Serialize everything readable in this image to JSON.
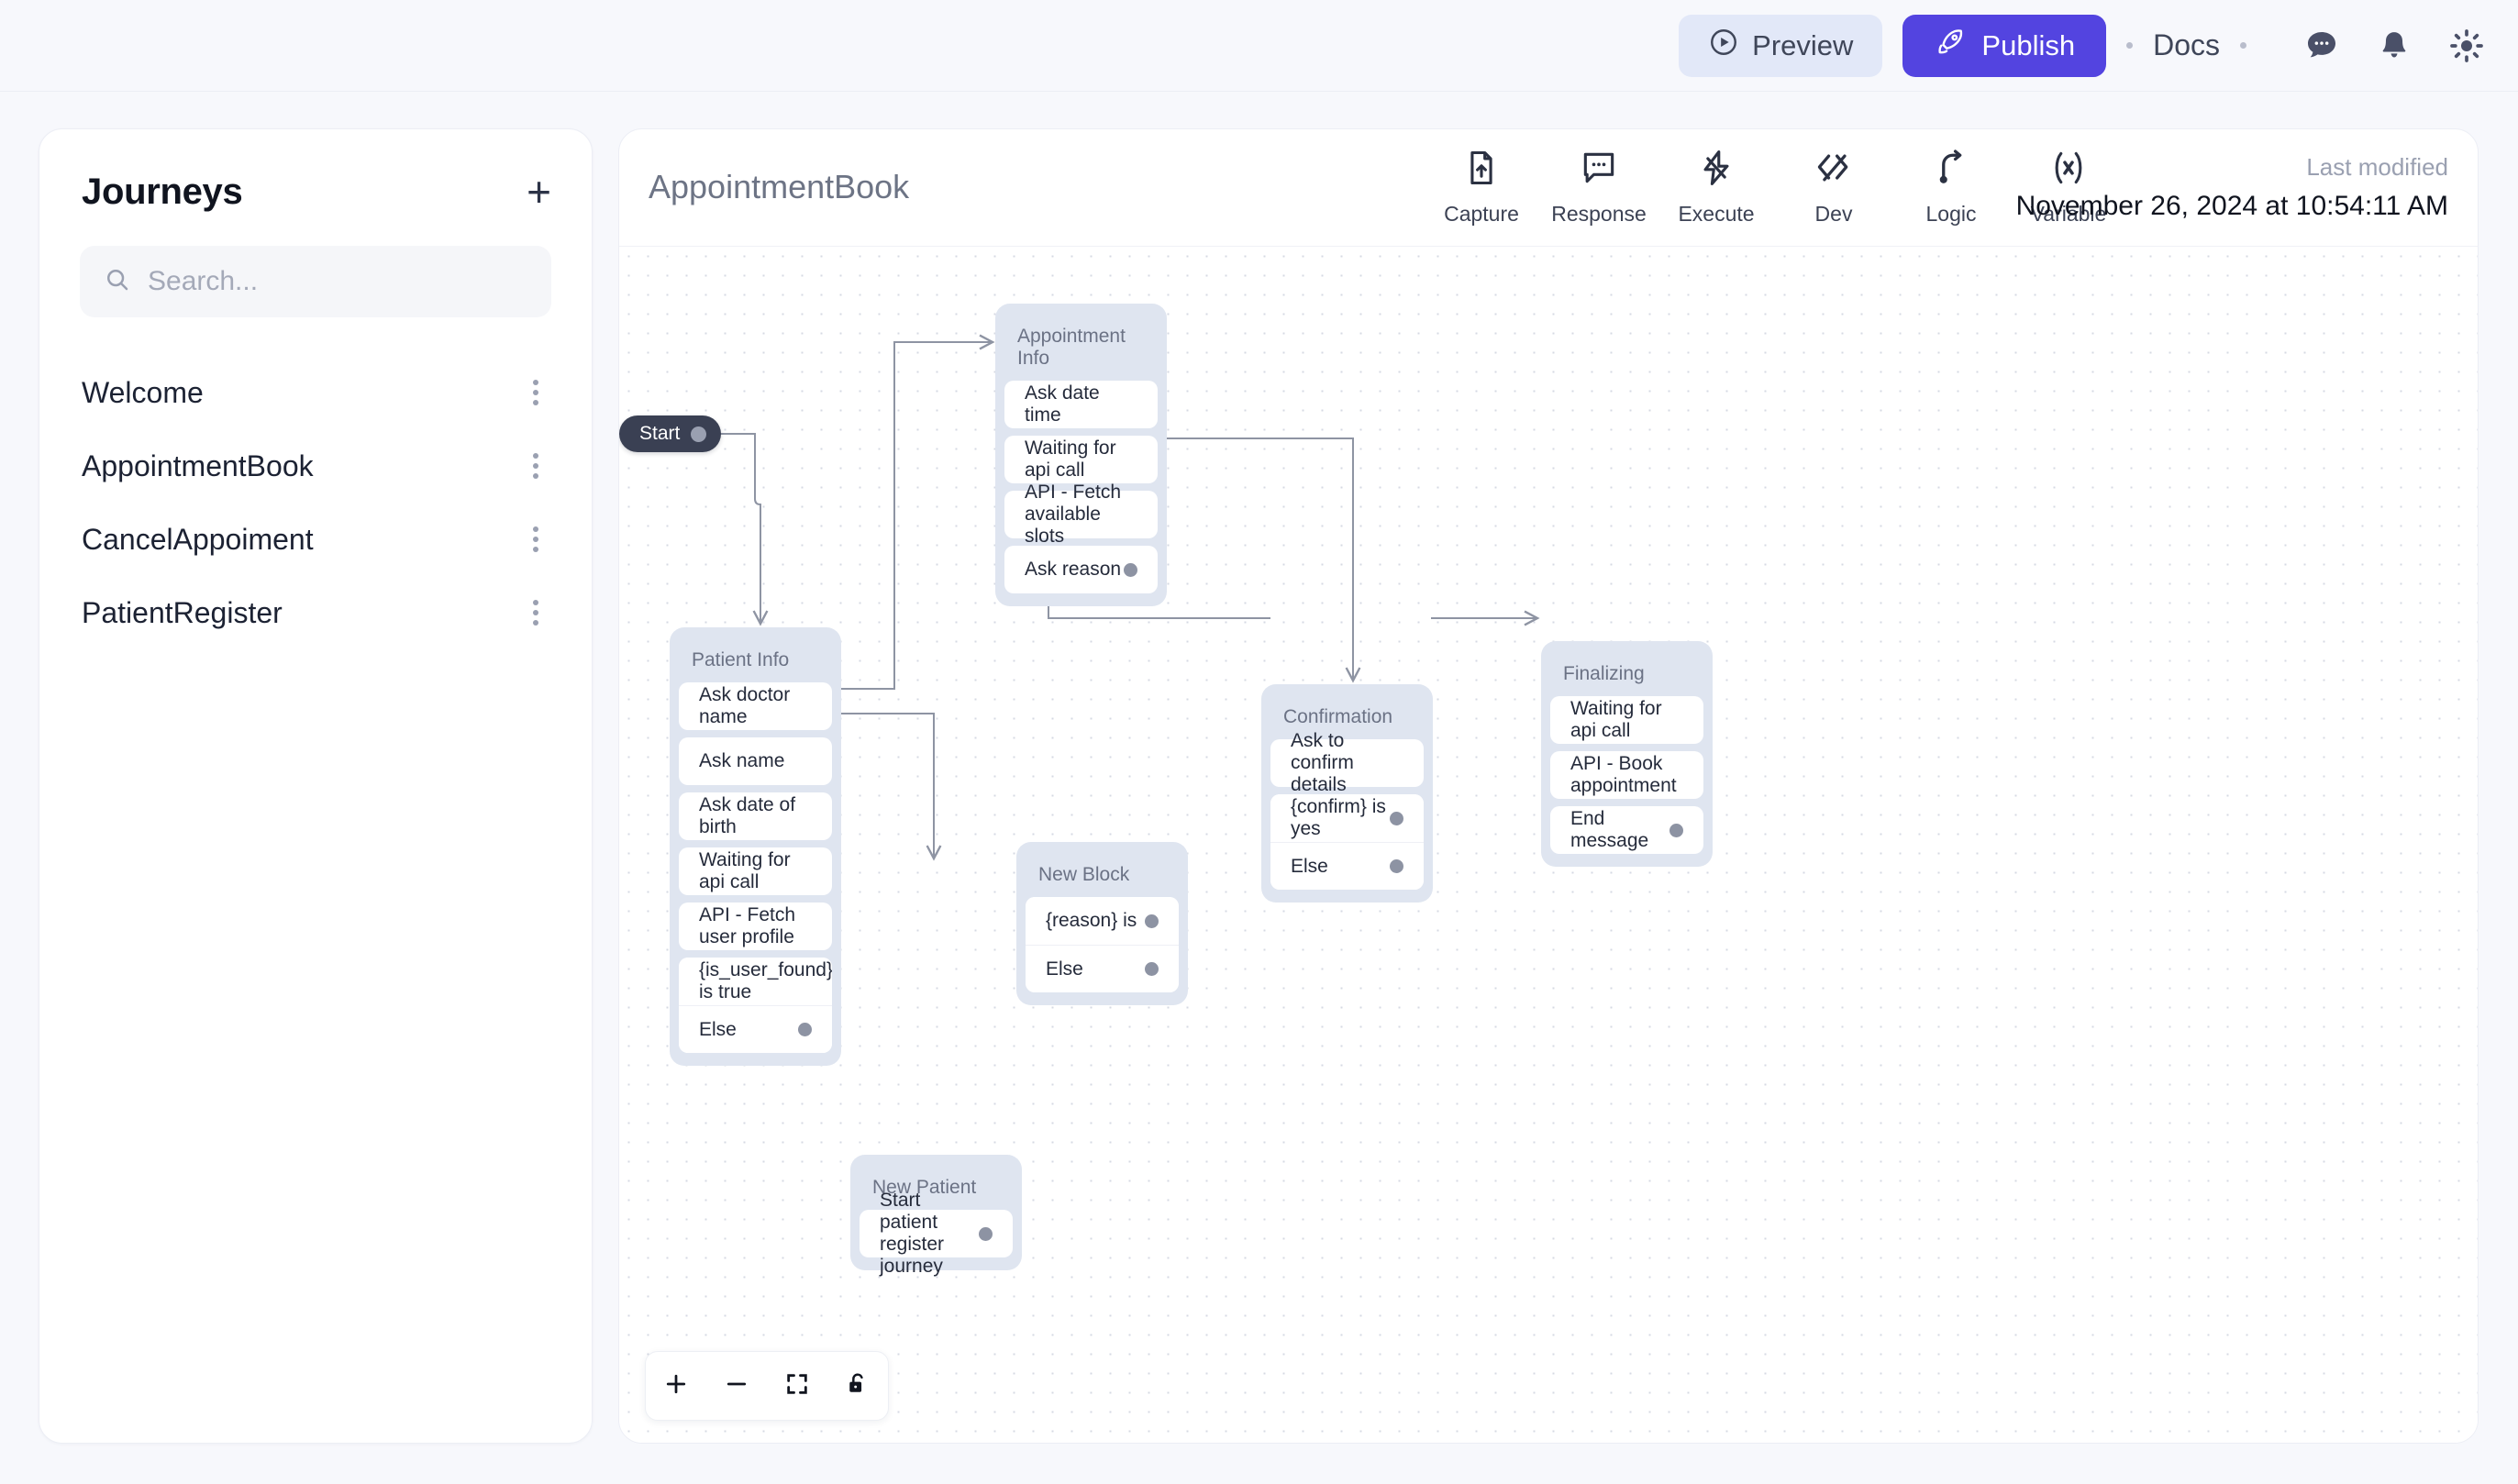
{
  "topbar": {
    "preview_label": "Preview",
    "publish_label": "Publish",
    "docs_label": "Docs",
    "accent_color": "#5344e0",
    "preview_bg": "#e2e8f8",
    "icons": [
      "play-circle-icon",
      "rocket-icon",
      "chat-icon",
      "bell-icon",
      "sun-icon"
    ]
  },
  "sidebar": {
    "title": "Journeys",
    "add_label": "+",
    "search": {
      "placeholder": "Search...",
      "value": ""
    },
    "items": [
      {
        "label": "Welcome"
      },
      {
        "label": "AppointmentBook"
      },
      {
        "label": "CancelAppoiment"
      },
      {
        "label": "PatientRegister"
      }
    ]
  },
  "canvas": {
    "flow_title": "AppointmentBook",
    "last_modified_label": "Last modified",
    "last_modified_value": "November 26, 2024 at 10:54:11 AM",
    "tools": [
      {
        "label": "Capture",
        "icon": "file-upload-icon"
      },
      {
        "label": "Response",
        "icon": "message-icon"
      },
      {
        "label": "Execute",
        "icon": "lightning-icon"
      },
      {
        "label": "Dev",
        "icon": "code-icon"
      },
      {
        "label": "Logic",
        "icon": "branch-arrow-icon"
      },
      {
        "label": "Variable",
        "icon": "variable-x-icon"
      }
    ],
    "controls": [
      {
        "name": "zoom-in",
        "icon": "plus-icon"
      },
      {
        "name": "zoom-out",
        "icon": "minus-icon"
      },
      {
        "name": "fit-view",
        "icon": "expand-icon"
      },
      {
        "name": "lock",
        "icon": "lock-icon"
      }
    ]
  },
  "flow": {
    "start_label": "Start",
    "nodes": [
      {
        "id": "appointment-info",
        "title": "Appointment Info",
        "rows": [
          {
            "label": "Ask date time",
            "port": false
          },
          {
            "label": "Waiting for api call",
            "port": false
          },
          {
            "label": "API - Fetch available slots",
            "port": false
          },
          {
            "label": "Ask reason",
            "port": true
          }
        ]
      },
      {
        "id": "patient-info",
        "title": "Patient Info",
        "rows": [
          {
            "label": "Ask doctor name",
            "port": false
          },
          {
            "label": "Ask name",
            "port": false
          },
          {
            "label": "Ask date of birth",
            "port": false
          },
          {
            "label": "Waiting for api call",
            "port": false
          },
          {
            "label": "API - Fetch user profile",
            "port": false
          }
        ],
        "group": [
          {
            "label": "{is_user_found} is true",
            "port": true
          },
          {
            "label": "Else",
            "port": true
          }
        ]
      },
      {
        "id": "confirmation",
        "title": "Confirmation",
        "rows": [
          {
            "label": "Ask to confirm details",
            "port": false
          }
        ],
        "group": [
          {
            "label": "{confirm} is yes",
            "port": true
          },
          {
            "label": "Else",
            "port": true
          }
        ]
      },
      {
        "id": "finalizing",
        "title": "Finalizing",
        "rows": [
          {
            "label": "Waiting for api call",
            "port": false
          },
          {
            "label": "API - Book appointment",
            "port": false
          },
          {
            "label": "End message",
            "port": true
          }
        ]
      },
      {
        "id": "new-block",
        "title": "New Block",
        "rows": [],
        "group": [
          {
            "label": "{reason} is",
            "port": true
          },
          {
            "label": "Else",
            "port": true
          }
        ]
      },
      {
        "id": "new-patient",
        "title": "New Patient",
        "rows": [
          {
            "label": "Start patient register journey",
            "port": true
          }
        ]
      }
    ]
  }
}
